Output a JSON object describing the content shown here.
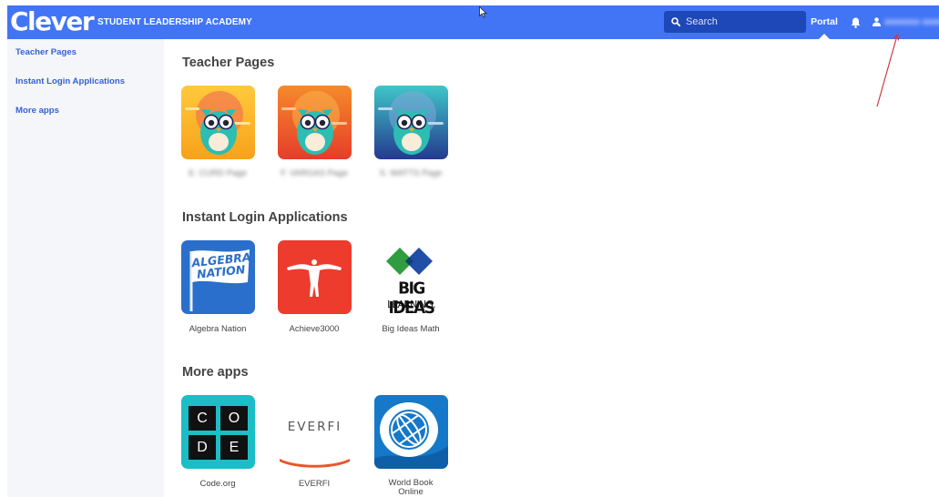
{
  "header": {
    "logo": "Clever",
    "district": "STUDENT LEADERSHIP ACADEMY",
    "search_placeholder": "Search",
    "portal_label": "Portal",
    "user_name": "xxxxxxx xxxxxx",
    "bar_color": "#4274f6"
  },
  "sidebar": {
    "items": [
      {
        "label": "Teacher Pages"
      },
      {
        "label": "Instant Login Applications"
      },
      {
        "label": "More apps"
      }
    ]
  },
  "sections": {
    "teacher_pages": {
      "title": "Teacher Pages",
      "apps": [
        {
          "name": "E. CURD Page",
          "blurred": true
        },
        {
          "name": "F. VARGAS Page",
          "blurred": true
        },
        {
          "name": "S. WATTS Page",
          "blurred": true
        }
      ]
    },
    "instant_login": {
      "title": "Instant Login Applications",
      "apps": [
        {
          "name": "Algebra Nation",
          "tile_text_1": "ALGEBRA",
          "tile_text_2": "NATION"
        },
        {
          "name": "Achieve3000"
        },
        {
          "name": "Big Ideas Math",
          "tile_text_1": "BIG IDEAS",
          "tile_text_2": "LEARNING."
        }
      ]
    },
    "more_apps": {
      "title": "More apps",
      "apps": [
        {
          "name": "Code.org",
          "tile_letters": [
            "C",
            "O",
            "D",
            "E"
          ]
        },
        {
          "name": "EVERFI",
          "tile_text": "EVERFI"
        },
        {
          "name": "World Book Online",
          "name_line_1": "World Book",
          "name_line_2": "Online"
        }
      ]
    }
  }
}
